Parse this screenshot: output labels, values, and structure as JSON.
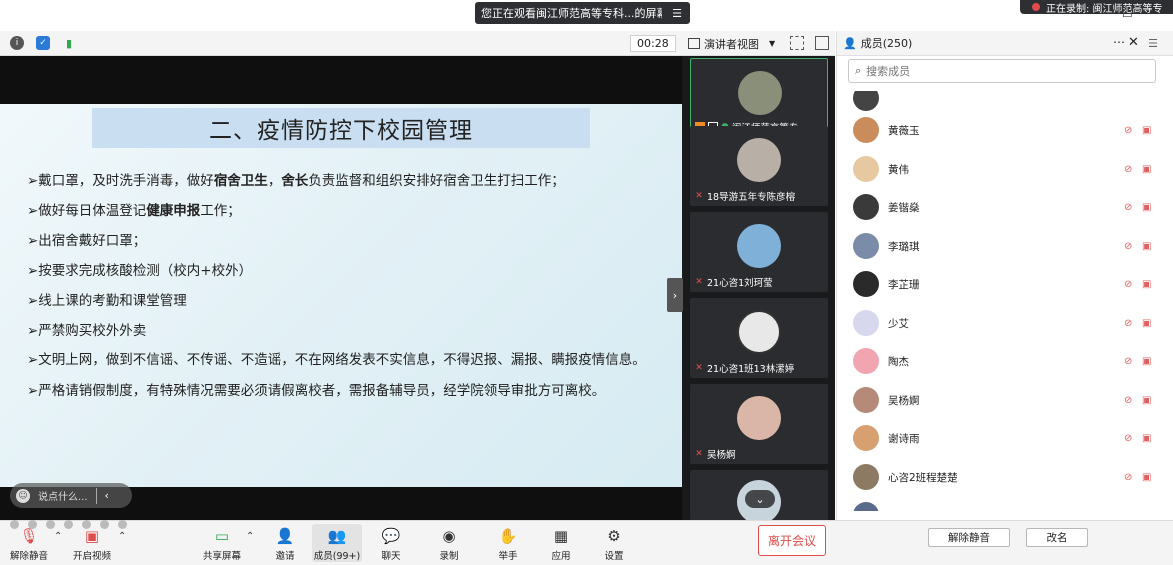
{
  "banner": {
    "sharing_text": "您正在观看闽江师范高等专科...的屏幕",
    "recording_text": "正在录制: 闽江师范高等专"
  },
  "toolbar": {
    "timer": "00:28",
    "view_label": "演讲者视图"
  },
  "slide": {
    "title": "二、疫情防控下校园管理",
    "bullets": [
      {
        "pre": "➢戴口罩，及时洗手消毒，做好",
        "b1": "宿舍卫生",
        "mid": "，",
        "b2": "舍长",
        "post": "负责监督和组织安排好宿舍卫生打扫工作；"
      },
      {
        "pre": "➢做好每日体温登记",
        "b1": "健康申报",
        "post": "工作；"
      },
      {
        "text": "➢出宿舍戴好口罩；"
      },
      {
        "text": "➢按要求完成核酸检测（校内+校外）"
      },
      {
        "text": "➢线上课的考勤和课堂管理"
      },
      {
        "text": "➢严禁购买校外外卖"
      },
      {
        "text": "➢文明上网，做到不信谣、不传谣、不造谣，不在网络发表不实信息，不得迟报、漏报、瞒报疫情信息。"
      },
      {
        "text": "➢严格请销假制度，有特殊情况需要必须请假离校者，需报备辅导员，经学院领导审批方可离校。"
      }
    ],
    "chat_placeholder": "说点什么..."
  },
  "videos": [
    {
      "label": "闽江师范高等专...",
      "color": "#8a8f7a",
      "active": true
    },
    {
      "label": "18导游五年专陈彦榕",
      "color": "#b8b0a6",
      "active": false
    },
    {
      "label": "21心咨1刘珂莹",
      "color": "#7fb0d8",
      "active": false
    },
    {
      "label": "21心咨1班13林潆婷",
      "color": "#e8e8e8",
      "active": false
    },
    {
      "label": "吴杨婀",
      "color": "#d9b6a8",
      "active": false
    }
  ],
  "members": {
    "title": "成员(250)",
    "search_placeholder": "搜索成员",
    "list": [
      {
        "name": "黄薇玉",
        "color": "#c98c5a"
      },
      {
        "name": "黄伟",
        "color": "#e6c9a0"
      },
      {
        "name": "姜锴燊",
        "color": "#3a3a3a"
      },
      {
        "name": "李璐琪",
        "color": "#7a8ca8"
      },
      {
        "name": "李芷珊",
        "color": "#2a2a2a"
      },
      {
        "name": "少艾",
        "color": "#d7d7ee"
      },
      {
        "name": "陶杰",
        "color": "#f1a5b0"
      },
      {
        "name": "吴杨婀",
        "color": "#b58a78"
      },
      {
        "name": "谢诗雨",
        "color": "#d8a070"
      },
      {
        "name": "心咨2班程楚楚",
        "color": "#8c7a63"
      }
    ],
    "unmute_all": "解除静音",
    "rename": "改名"
  },
  "bottom": {
    "unmute": "解除静音",
    "start_video": "开启视频",
    "share_screen": "共享屏幕",
    "invite": "邀请",
    "members": "成员(99+)",
    "chat": "聊天",
    "record": "录制",
    "raise_hand": "举手",
    "apps": "应用",
    "settings": "设置",
    "leave": "离开会议"
  },
  "colors": {
    "accent_green": "#3fb36a",
    "leave_red": "#e04b4b",
    "slide_title_bg": "#c9dff1"
  }
}
